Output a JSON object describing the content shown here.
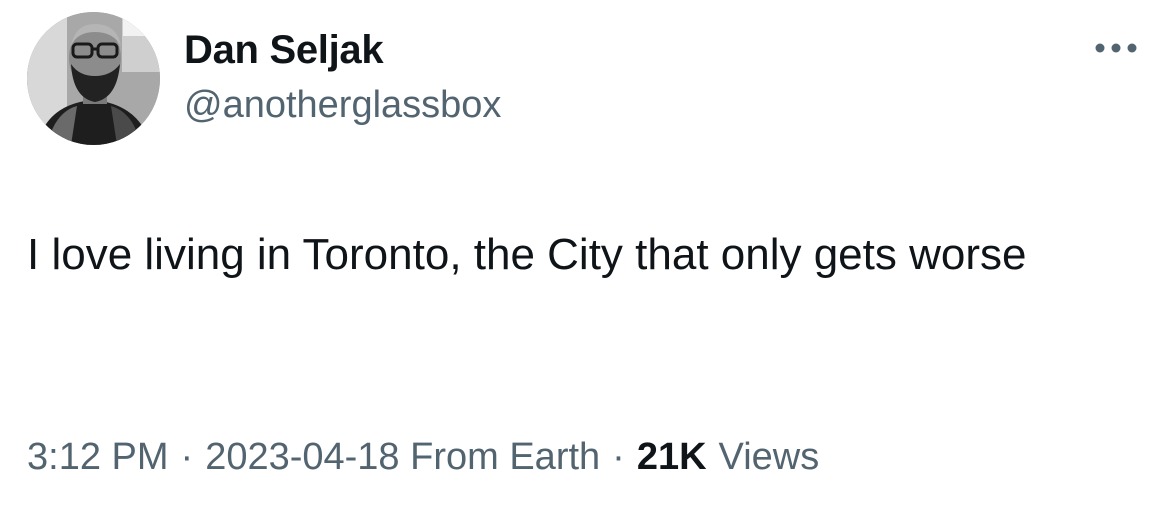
{
  "author": {
    "display_name": "Dan Seljak",
    "handle": "@anotherglassbox",
    "avatar_icon": "profile-photo-icon"
  },
  "more_icon": "more-horizontal-icon",
  "tweet": {
    "text": "I love living in Toronto, the City that only gets worse"
  },
  "meta": {
    "time": "3:12 PM",
    "separator": "·",
    "date_location": "2023-04-18 From Earth",
    "views_count": "21K",
    "views_label": "Views"
  },
  "colors": {
    "primary_text": "#0f1419",
    "secondary_text": "#536471",
    "background": "#ffffff"
  }
}
